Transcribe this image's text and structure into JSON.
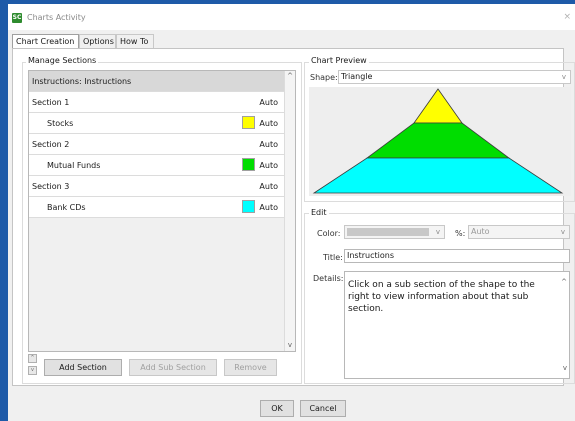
{
  "window": {
    "icon_label": "SC",
    "title": "Charts Activity",
    "close_glyph": "×"
  },
  "tabs": [
    {
      "label": "Chart Creation",
      "active": true
    },
    {
      "label": "Options",
      "active": false
    },
    {
      "label": "How To",
      "active": false
    }
  ],
  "manage": {
    "group_label": "Manage Sections",
    "rows": [
      {
        "label": "Instructions: Instructions",
        "selected": true,
        "indent": false,
        "auto": "",
        "color": ""
      },
      {
        "label": "Section 1",
        "selected": false,
        "indent": false,
        "auto": "Auto",
        "color": ""
      },
      {
        "label": "Stocks",
        "selected": false,
        "indent": true,
        "auto": "Auto",
        "color": "#ffff00"
      },
      {
        "label": "Section 2",
        "selected": false,
        "indent": false,
        "auto": "Auto",
        "color": ""
      },
      {
        "label": "Mutual Funds",
        "selected": false,
        "indent": true,
        "auto": "Auto",
        "color": "#00dd00"
      },
      {
        "label": "Section 3",
        "selected": false,
        "indent": false,
        "auto": "Auto",
        "color": ""
      },
      {
        "label": "Bank CDs",
        "selected": false,
        "indent": true,
        "auto": "Auto",
        "color": "#00ffff"
      }
    ],
    "scroll_up": "^",
    "scroll_down": "v",
    "move_up_glyph": "^",
    "move_down_glyph": "v",
    "add_section_label": "Add Section",
    "add_sub_section_label": "Add Sub Section",
    "remove_label": "Remove"
  },
  "preview": {
    "group_label": "Chart Preview",
    "shape_label": "Shape:",
    "shape_value": "Triangle",
    "chevron": "v",
    "layers": [
      {
        "name": "Stocks",
        "color": "#ffff00"
      },
      {
        "name": "Mutual Funds",
        "color": "#00dd00"
      },
      {
        "name": "Bank CDs",
        "color": "#00ffff"
      }
    ]
  },
  "edit": {
    "group_label": "Edit",
    "color_label": "Color:",
    "color_chevron": "v",
    "pct_label": "%:",
    "pct_value": "Auto",
    "pct_chevron": "v",
    "title_label": "Title:",
    "title_value": "Instructions",
    "details_label": "Details:",
    "details_value": "Click on a sub section of the shape to the right to view information about that sub section.",
    "details_scroll_up": "^",
    "details_scroll_down": "v"
  },
  "footer": {
    "ok_label": "OK",
    "cancel_label": "Cancel"
  },
  "colors": {
    "accent": "#1e5aa8",
    "yellow": "#ffff00",
    "green": "#00dd00",
    "cyan": "#00ffff"
  }
}
